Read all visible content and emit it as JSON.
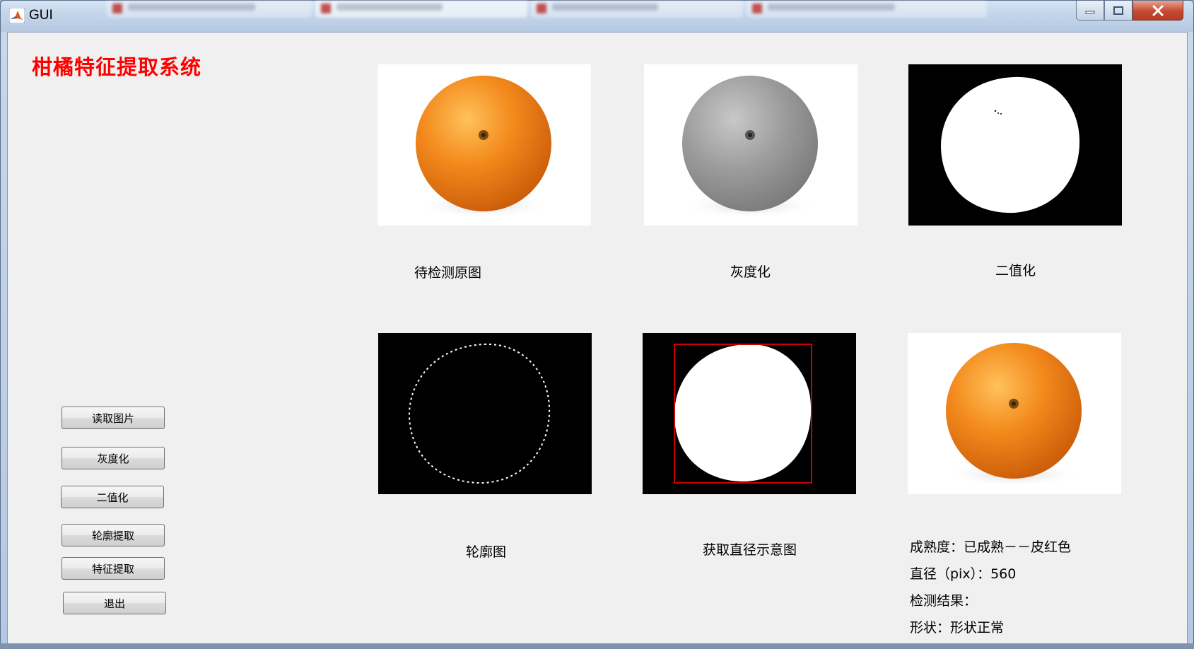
{
  "window": {
    "title": "GUI"
  },
  "app": {
    "heading": "柑橘特征提取系统"
  },
  "panels": {
    "original_caption": "待检测原图",
    "gray_caption": "灰度化",
    "binary_caption": "二值化",
    "contour_caption": "轮廓图",
    "diameter_caption": "获取直径示意图"
  },
  "buttons": {
    "read_image": "读取图片",
    "grayscale": "灰度化",
    "binarize": "二值化",
    "contour_extract": "轮廓提取",
    "feature_extract": "特征提取",
    "exit": "退出"
  },
  "results": {
    "ripeness": "成熟度：已成熟－－皮红色",
    "diameter": "直径（pix）：560",
    "detection_label": "检测结果：",
    "shape": "形状：形状正常"
  },
  "colors": {
    "heading": "#ff0000",
    "orange_fruit": "#f08a1e",
    "bounding_box": "#cc0000"
  }
}
